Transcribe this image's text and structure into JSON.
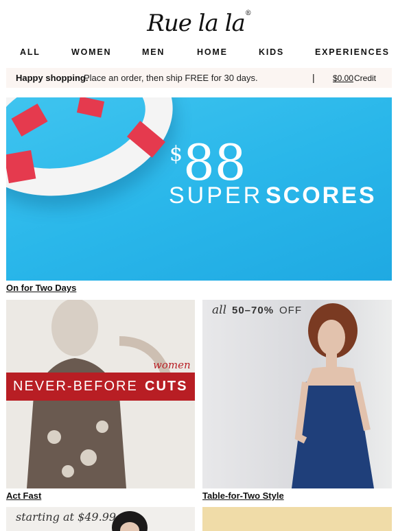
{
  "brand": {
    "logo_text": "Rue la la"
  },
  "nav": {
    "items": [
      {
        "label": "ALL"
      },
      {
        "label": "WOMEN"
      },
      {
        "label": "MEN"
      },
      {
        "label": "HOME"
      },
      {
        "label": "KIDS"
      },
      {
        "label": "EXPERIENCES"
      }
    ]
  },
  "promo": {
    "bold": "Happy shopping.",
    "text": "Place an order, then ship FREE for 30 days.",
    "separator": "|",
    "credit_amount": "$0.00",
    "credit_label": "Credit"
  },
  "hero": {
    "currency": "$",
    "amount": "88",
    "line_a": "SUPER",
    "line_b": "SCORES",
    "caption": "On for Two Days"
  },
  "cards": [
    {
      "tag": "women",
      "headline_a": "NEVER-BEFORE",
      "headline_b": "CUTS",
      "caption": "Act Fast"
    },
    {
      "prefix": "all",
      "percent": "50–70%",
      "suffix": "OFF",
      "caption": "Table-for-Two Style"
    },
    {
      "starting": "starting at $49.99"
    },
    {}
  ],
  "colors": {
    "accent_red": "#b81e24",
    "hero_blue": "#2ab7ea",
    "promo_bg": "#fbf5f2"
  }
}
